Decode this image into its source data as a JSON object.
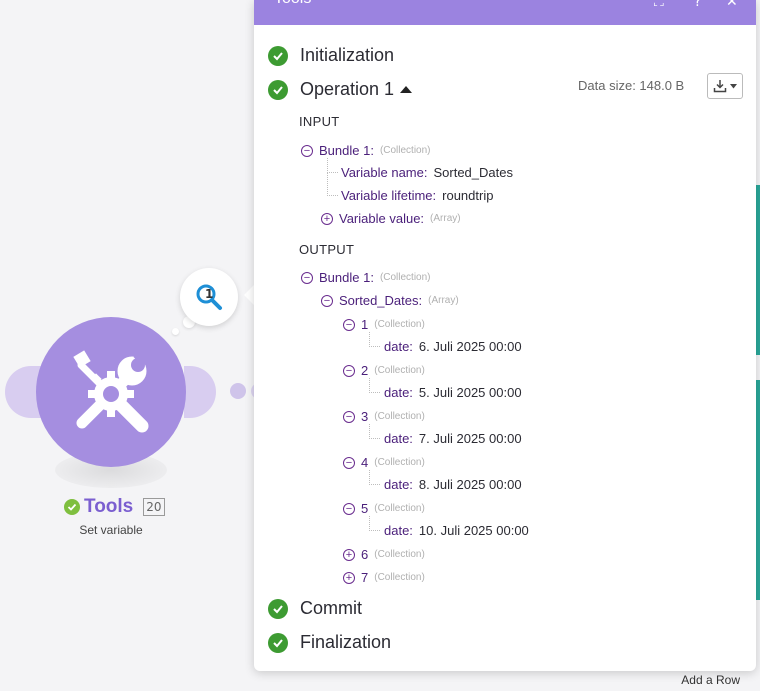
{
  "panel": {
    "title": "Tools",
    "phases": {
      "initialization": "Initialization",
      "operation": "Operation 1",
      "commit": "Commit",
      "finalization": "Finalization"
    },
    "data_size": "Data size: 148.0 B",
    "input_label": "INPUT",
    "output_label": "OUTPUT",
    "input": {
      "bundle_key": "Bundle 1:",
      "bundle_type": "(Collection)",
      "var_name_key": "Variable name:",
      "var_name_val": "Sorted_Dates",
      "var_life_key": "Variable lifetime:",
      "var_life_val": "roundtrip",
      "var_value_key": "Variable value:",
      "var_value_type": "(Array)"
    },
    "output": {
      "bundle_key": "Bundle 1:",
      "bundle_type": "(Collection)",
      "sorted_key": "Sorted_Dates:",
      "sorted_type": "(Array)",
      "items": [
        {
          "index": "1",
          "type": "(Collection)",
          "date_key": "date:",
          "date_val": "6. Juli 2025 00:00"
        },
        {
          "index": "2",
          "type": "(Collection)",
          "date_key": "date:",
          "date_val": "5. Juli 2025 00:00"
        },
        {
          "index": "3",
          "type": "(Collection)",
          "date_key": "date:",
          "date_val": "7. Juli 2025 00:00"
        },
        {
          "index": "4",
          "type": "(Collection)",
          "date_key": "date:",
          "date_val": "8. Juli 2025 00:00"
        },
        {
          "index": "5",
          "type": "(Collection)",
          "date_key": "date:",
          "date_val": "10. Juli 2025 00:00"
        },
        {
          "index": "6",
          "type": "(Collection)"
        },
        {
          "index": "7",
          "type": "(Collection)"
        }
      ]
    }
  },
  "module": {
    "name": "Tools",
    "id": "20",
    "subtitle": "Set variable",
    "bubble_count": "1",
    "icon": "tools-wrench-gear-icon",
    "color": "#a58ee0"
  },
  "canvas": {
    "add_row": "Add a Row"
  },
  "colors": {
    "header": "#9b83e0",
    "success": "#3d9b32",
    "key_text": "#4a1f7a"
  }
}
